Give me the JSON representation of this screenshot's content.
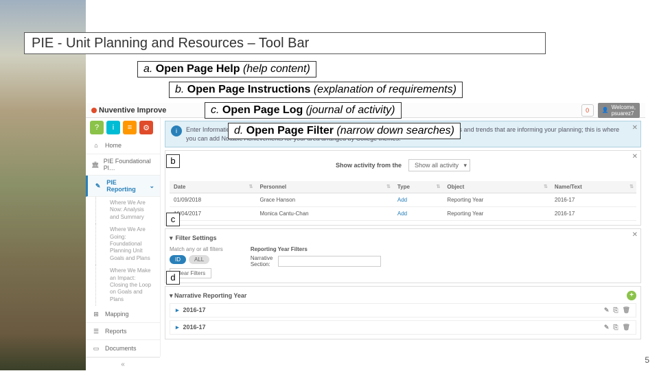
{
  "title": "PIE - Unit Planning and Resources – Tool Bar",
  "labels": {
    "a": {
      "prefix": "a. ",
      "bold": "Open Page Help",
      "suffix": " (help content)"
    },
    "b": {
      "prefix": "b. ",
      "bold": "Open Page Instructions",
      "suffix": " (explanation of requirements)"
    },
    "c": {
      "prefix": "c. ",
      "bold": "Open Page Log",
      "suffix": " (journal of activity)"
    },
    "d": {
      "prefix": "d. ",
      "bold": "Open Page Filter",
      "suffix": " (narrow down searches)"
    }
  },
  "markers": {
    "b": "b",
    "c": "c",
    "d": "d"
  },
  "app": {
    "logo": "Nuventive Improve",
    "user_welcome": "Welcome,",
    "user_name": "psuarez7",
    "notif": "0"
  },
  "tools": {
    "help": "?",
    "instr": "i",
    "log": "≡",
    "filter": "⚙"
  },
  "nav": {
    "home": "Home",
    "foundational": "PIE Foundational Pl…",
    "reporting": "PIE Reporting",
    "sub1": "Where We Are Now: Analysis and Summary",
    "sub2": "Where We Are Going: Foundational Planning Unit Goals and Plans",
    "sub3": "Where We Make an Impact: Closing the Loop on Goals and Plans",
    "mapping": "Mapping",
    "reports": "Reports",
    "documents": "Documents"
  },
  "instructions": "Enter Information for your Unit here. Text boxes are provided to allow for documentation of conditions and trends that are informing your planning; this is where you can add Notable Achievements for your area arranged by College themes.",
  "log": {
    "label": "Show activity from the",
    "select": "Show all activity",
    "headers": {
      "date": "Date",
      "personnel": "Personnel",
      "type": "Type",
      "object": "Object",
      "name": "Name/Text"
    },
    "rows": [
      {
        "date": "01/09/2018",
        "personnel": "Grace Hanson",
        "type": "Add",
        "object": "Reporting Year",
        "name": "2016-17"
      },
      {
        "date": "10/04/2017",
        "personnel": "Monica Cantu-Chan",
        "type": "Add",
        "object": "Reporting Year",
        "name": "2016-17"
      }
    ]
  },
  "filter": {
    "head": "Filter Settings",
    "match": "Match any or all filters",
    "id": "ID",
    "all": "ALL",
    "clear": "Clear Filters",
    "ry_head": "Reporting Year Filters",
    "narrative": "Narrative",
    "section": "Section:"
  },
  "narrative": {
    "head": "Narrative Reporting Year",
    "rows": [
      "2016-17",
      "2016-17"
    ]
  },
  "page_number": "5"
}
